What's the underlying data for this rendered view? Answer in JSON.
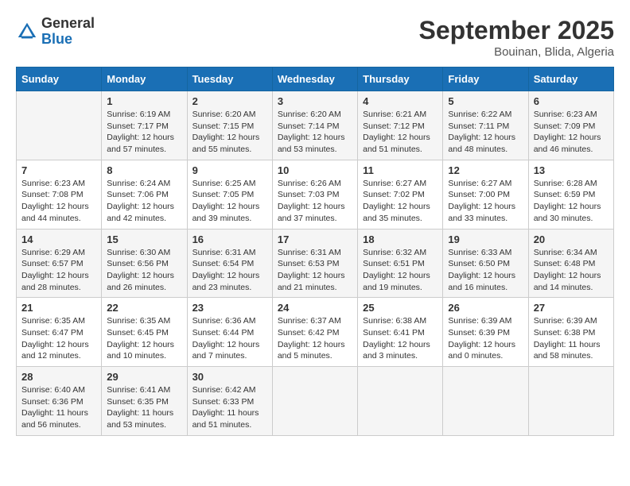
{
  "header": {
    "logo_general": "General",
    "logo_blue": "Blue",
    "month_title": "September 2025",
    "location": "Bouinan, Blida, Algeria"
  },
  "days_of_week": [
    "Sunday",
    "Monday",
    "Tuesday",
    "Wednesday",
    "Thursday",
    "Friday",
    "Saturday"
  ],
  "weeks": [
    [
      {
        "num": "",
        "info": ""
      },
      {
        "num": "1",
        "info": "Sunrise: 6:19 AM\nSunset: 7:17 PM\nDaylight: 12 hours\nand 57 minutes."
      },
      {
        "num": "2",
        "info": "Sunrise: 6:20 AM\nSunset: 7:15 PM\nDaylight: 12 hours\nand 55 minutes."
      },
      {
        "num": "3",
        "info": "Sunrise: 6:20 AM\nSunset: 7:14 PM\nDaylight: 12 hours\nand 53 minutes."
      },
      {
        "num": "4",
        "info": "Sunrise: 6:21 AM\nSunset: 7:12 PM\nDaylight: 12 hours\nand 51 minutes."
      },
      {
        "num": "5",
        "info": "Sunrise: 6:22 AM\nSunset: 7:11 PM\nDaylight: 12 hours\nand 48 minutes."
      },
      {
        "num": "6",
        "info": "Sunrise: 6:23 AM\nSunset: 7:09 PM\nDaylight: 12 hours\nand 46 minutes."
      }
    ],
    [
      {
        "num": "7",
        "info": "Sunrise: 6:23 AM\nSunset: 7:08 PM\nDaylight: 12 hours\nand 44 minutes."
      },
      {
        "num": "8",
        "info": "Sunrise: 6:24 AM\nSunset: 7:06 PM\nDaylight: 12 hours\nand 42 minutes."
      },
      {
        "num": "9",
        "info": "Sunrise: 6:25 AM\nSunset: 7:05 PM\nDaylight: 12 hours\nand 39 minutes."
      },
      {
        "num": "10",
        "info": "Sunrise: 6:26 AM\nSunset: 7:03 PM\nDaylight: 12 hours\nand 37 minutes."
      },
      {
        "num": "11",
        "info": "Sunrise: 6:27 AM\nSunset: 7:02 PM\nDaylight: 12 hours\nand 35 minutes."
      },
      {
        "num": "12",
        "info": "Sunrise: 6:27 AM\nSunset: 7:00 PM\nDaylight: 12 hours\nand 33 minutes."
      },
      {
        "num": "13",
        "info": "Sunrise: 6:28 AM\nSunset: 6:59 PM\nDaylight: 12 hours\nand 30 minutes."
      }
    ],
    [
      {
        "num": "14",
        "info": "Sunrise: 6:29 AM\nSunset: 6:57 PM\nDaylight: 12 hours\nand 28 minutes."
      },
      {
        "num": "15",
        "info": "Sunrise: 6:30 AM\nSunset: 6:56 PM\nDaylight: 12 hours\nand 26 minutes."
      },
      {
        "num": "16",
        "info": "Sunrise: 6:31 AM\nSunset: 6:54 PM\nDaylight: 12 hours\nand 23 minutes."
      },
      {
        "num": "17",
        "info": "Sunrise: 6:31 AM\nSunset: 6:53 PM\nDaylight: 12 hours\nand 21 minutes."
      },
      {
        "num": "18",
        "info": "Sunrise: 6:32 AM\nSunset: 6:51 PM\nDaylight: 12 hours\nand 19 minutes."
      },
      {
        "num": "19",
        "info": "Sunrise: 6:33 AM\nSunset: 6:50 PM\nDaylight: 12 hours\nand 16 minutes."
      },
      {
        "num": "20",
        "info": "Sunrise: 6:34 AM\nSunset: 6:48 PM\nDaylight: 12 hours\nand 14 minutes."
      }
    ],
    [
      {
        "num": "21",
        "info": "Sunrise: 6:35 AM\nSunset: 6:47 PM\nDaylight: 12 hours\nand 12 minutes."
      },
      {
        "num": "22",
        "info": "Sunrise: 6:35 AM\nSunset: 6:45 PM\nDaylight: 12 hours\nand 10 minutes."
      },
      {
        "num": "23",
        "info": "Sunrise: 6:36 AM\nSunset: 6:44 PM\nDaylight: 12 hours\nand 7 minutes."
      },
      {
        "num": "24",
        "info": "Sunrise: 6:37 AM\nSunset: 6:42 PM\nDaylight: 12 hours\nand 5 minutes."
      },
      {
        "num": "25",
        "info": "Sunrise: 6:38 AM\nSunset: 6:41 PM\nDaylight: 12 hours\nand 3 minutes."
      },
      {
        "num": "26",
        "info": "Sunrise: 6:39 AM\nSunset: 6:39 PM\nDaylight: 12 hours\nand 0 minutes."
      },
      {
        "num": "27",
        "info": "Sunrise: 6:39 AM\nSunset: 6:38 PM\nDaylight: 11 hours\nand 58 minutes."
      }
    ],
    [
      {
        "num": "28",
        "info": "Sunrise: 6:40 AM\nSunset: 6:36 PM\nDaylight: 11 hours\nand 56 minutes."
      },
      {
        "num": "29",
        "info": "Sunrise: 6:41 AM\nSunset: 6:35 PM\nDaylight: 11 hours\nand 53 minutes."
      },
      {
        "num": "30",
        "info": "Sunrise: 6:42 AM\nSunset: 6:33 PM\nDaylight: 11 hours\nand 51 minutes."
      },
      {
        "num": "",
        "info": ""
      },
      {
        "num": "",
        "info": ""
      },
      {
        "num": "",
        "info": ""
      },
      {
        "num": "",
        "info": ""
      }
    ]
  ]
}
